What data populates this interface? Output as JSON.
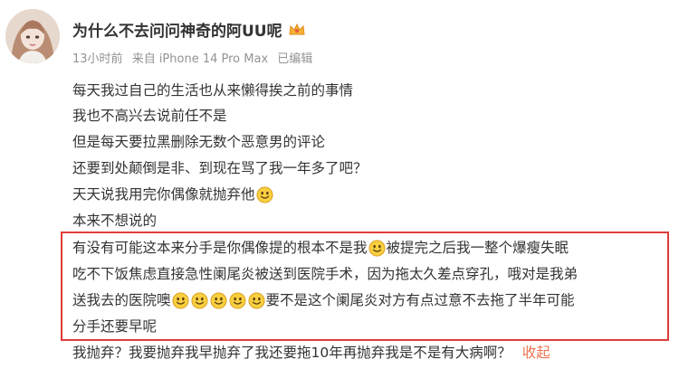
{
  "post": {
    "username": "为什么不去问问神奇的阿UU呢",
    "time": "13小时前",
    "source": "来自 iPhone 14 Pro Max",
    "edited": "已编辑",
    "lines": [
      {
        "segments": [
          {
            "t": "text",
            "v": "每天我过自己的生活也从来懒得挨之前的事情"
          }
        ]
      },
      {
        "segments": [
          {
            "t": "text",
            "v": "我也不高兴去说前任不是"
          }
        ]
      },
      {
        "segments": [
          {
            "t": "text",
            "v": "但是每天要拉黑删除无数个恶意男的评论"
          }
        ]
      },
      {
        "segments": [
          {
            "t": "text",
            "v": "还要到处颠倒是非、到现在骂了我一年多了吧？"
          }
        ]
      },
      {
        "segments": [
          {
            "t": "text",
            "v": "天天说我用完你偶像就抛弃他"
          },
          {
            "t": "emoji"
          }
        ]
      },
      {
        "segments": [
          {
            "t": "text",
            "v": "本来不想说的"
          }
        ]
      },
      {
        "segments": [
          {
            "t": "text",
            "v": "有没有可能这本来分手是你偶像提的根本不是我"
          },
          {
            "t": "emoji"
          },
          {
            "t": "text",
            "v": "被提完之后我一整个爆瘦失眠"
          }
        ]
      },
      {
        "segments": [
          {
            "t": "text",
            "v": "吃不下饭焦虑直接急性阑尾炎被送到医院手术，因为拖太久差点穿孔，哦对是我弟"
          }
        ]
      },
      {
        "segments": [
          {
            "t": "text",
            "v": "送我去的医院噢"
          },
          {
            "t": "emoji"
          },
          {
            "t": "emoji"
          },
          {
            "t": "emoji"
          },
          {
            "t": "emoji"
          },
          {
            "t": "emoji"
          },
          {
            "t": "text",
            "v": "要不是这个阑尾炎对方有点过意不去拖了半年可能"
          }
        ]
      },
      {
        "segments": [
          {
            "t": "text",
            "v": "分手还要早呢"
          }
        ]
      },
      {
        "segments": [
          {
            "t": "text",
            "v": "我抛弃？我要抛弃我早抛弃了我还要拖10年再抛弃我是不是有大病啊？"
          },
          {
            "t": "link",
            "v": "收起"
          }
        ]
      }
    ]
  },
  "colors": {
    "highlight_border": "#e03b3b",
    "link": "#eb7350",
    "meta": "#939393",
    "text": "#333333"
  },
  "icons": {
    "badge": "crown-icon",
    "emoji": "smile-emoji-icon"
  }
}
